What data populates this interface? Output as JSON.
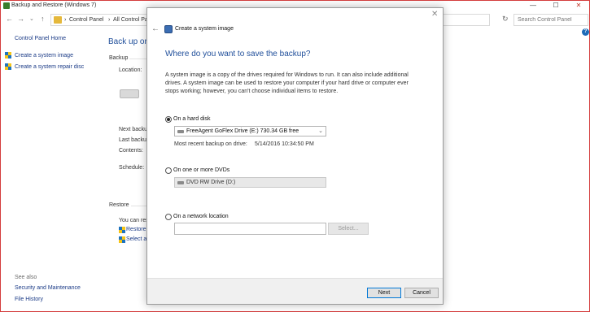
{
  "window": {
    "title": "Backup and Restore (Windows 7)",
    "controls": {
      "minimize": "—",
      "maximize": "☐",
      "close": "✕"
    }
  },
  "address_bar": {
    "back": "←",
    "forward": "→",
    "dropdown": "⌄",
    "up": "↑",
    "crumbs": [
      "›",
      "Control Panel",
      "›",
      "All Control Pa"
    ],
    "refresh": "↻",
    "search_placeholder": "Search Control Panel"
  },
  "left_pane": {
    "home": "Control Panel Home",
    "links": [
      "Create a system image",
      "Create a system repair disc"
    ],
    "see_also_title": "See also",
    "see_also": [
      "Security and Maintenance",
      "File History"
    ]
  },
  "main_pane": {
    "heading": "Back up or",
    "backup_group": "Backup",
    "location_label": "Location:",
    "fields": [
      "Next backup",
      "Last backup",
      "Contents:",
      "Schedule:"
    ],
    "restore_group": "Restore",
    "restore_text": "You can res",
    "restore_links": [
      "Restore",
      "Select an"
    ]
  },
  "dialog": {
    "close": "✕",
    "back": "←",
    "title": "Create a system image",
    "heading": "Where do you want to save the backup?",
    "description": "A system image is a copy of the drives required for Windows to run. It can also include additional drives. A system image can be used to restore your computer if your hard drive or computer ever stops working; however, you can't choose individual items to restore.",
    "options": {
      "hard_disk": {
        "label": "On a hard disk",
        "checked": true,
        "drive": "FreeAgent GoFlex Drive (E:)  730.34 GB free",
        "recent_label": "Most recent backup on drive:",
        "recent_value": "5/14/2016 10:34:50 PM"
      },
      "dvds": {
        "label": "On one or more DVDs",
        "checked": false,
        "drive": "DVD RW Drive (D:)"
      },
      "network": {
        "label": "On a network location",
        "checked": false,
        "select_button": "Select..."
      }
    },
    "buttons": {
      "next": "Next",
      "cancel": "Cancel"
    }
  }
}
